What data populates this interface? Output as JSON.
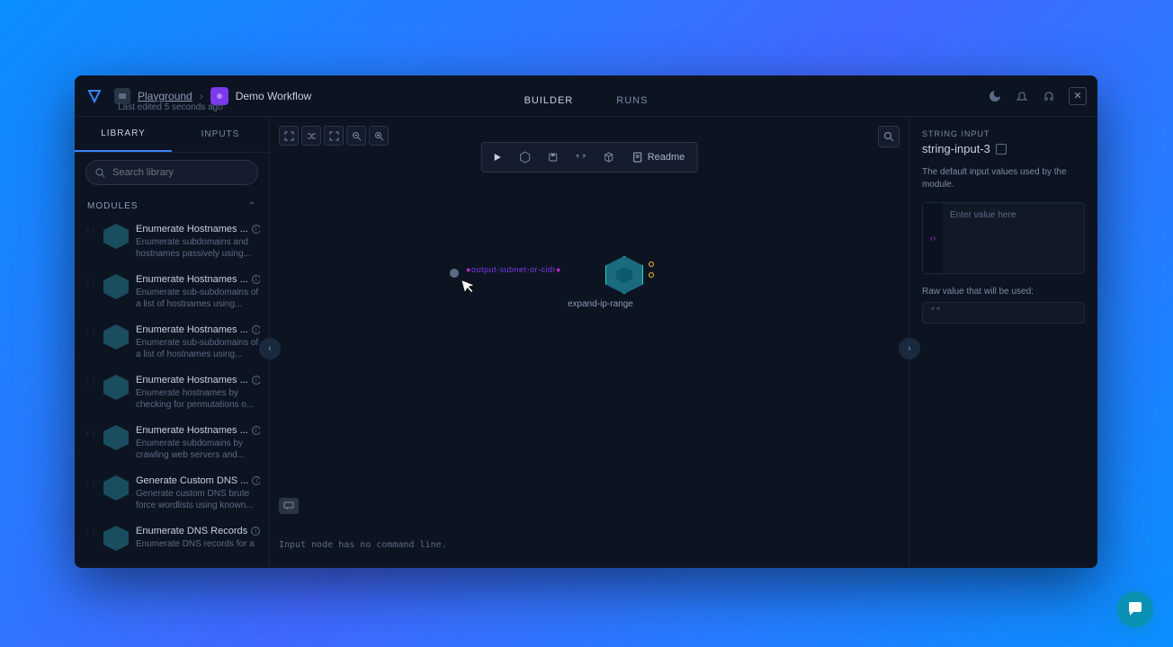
{
  "breadcrumb": {
    "parent": "Playground",
    "current": "Demo Workflow"
  },
  "last_edited": "Last edited 5 seconds ago",
  "tabs": {
    "builder": "BUILDER",
    "runs": "RUNS"
  },
  "sidebar": {
    "tabs": {
      "library": "LIBRARY",
      "inputs": "INPUTS"
    },
    "search_placeholder": "Search library",
    "section_header": "MODULES",
    "modules": [
      {
        "title": "Enumerate Hostnames ...",
        "desc": "Enumerate subdomains and hostnames passively using..."
      },
      {
        "title": "Enumerate Hostnames ...",
        "desc": "Enumerate sub-subdomains of a list of hostnames using..."
      },
      {
        "title": "Enumerate Hostnames ...",
        "desc": "Enumerate sub-subdomains of a list of hostnames using..."
      },
      {
        "title": "Enumerate Hostnames ...",
        "desc": "Enumerate hostnames by checking for permutations o..."
      },
      {
        "title": "Enumerate Hostnames ...",
        "desc": "Enumerate subdomains by crawling web servers and..."
      },
      {
        "title": "Generate Custom DNS ...",
        "desc": "Generate custom DNS brute force wordlists using known..."
      },
      {
        "title": "Enumerate DNS Records",
        "desc": "Enumerate DNS records for a"
      }
    ]
  },
  "toolbar": {
    "readme": "Readme"
  },
  "canvas": {
    "edge_label": "output-subnet-or-cidr",
    "node_label": "expand-ip-range",
    "console_text": "Input node has no command line."
  },
  "right_panel": {
    "label": "STRING INPUT",
    "title": "string-input-3",
    "description": "The default input values used by the module.",
    "placeholder": "Enter value here",
    "raw_label": "Raw value that will be used:",
    "raw_value": "\"\""
  }
}
